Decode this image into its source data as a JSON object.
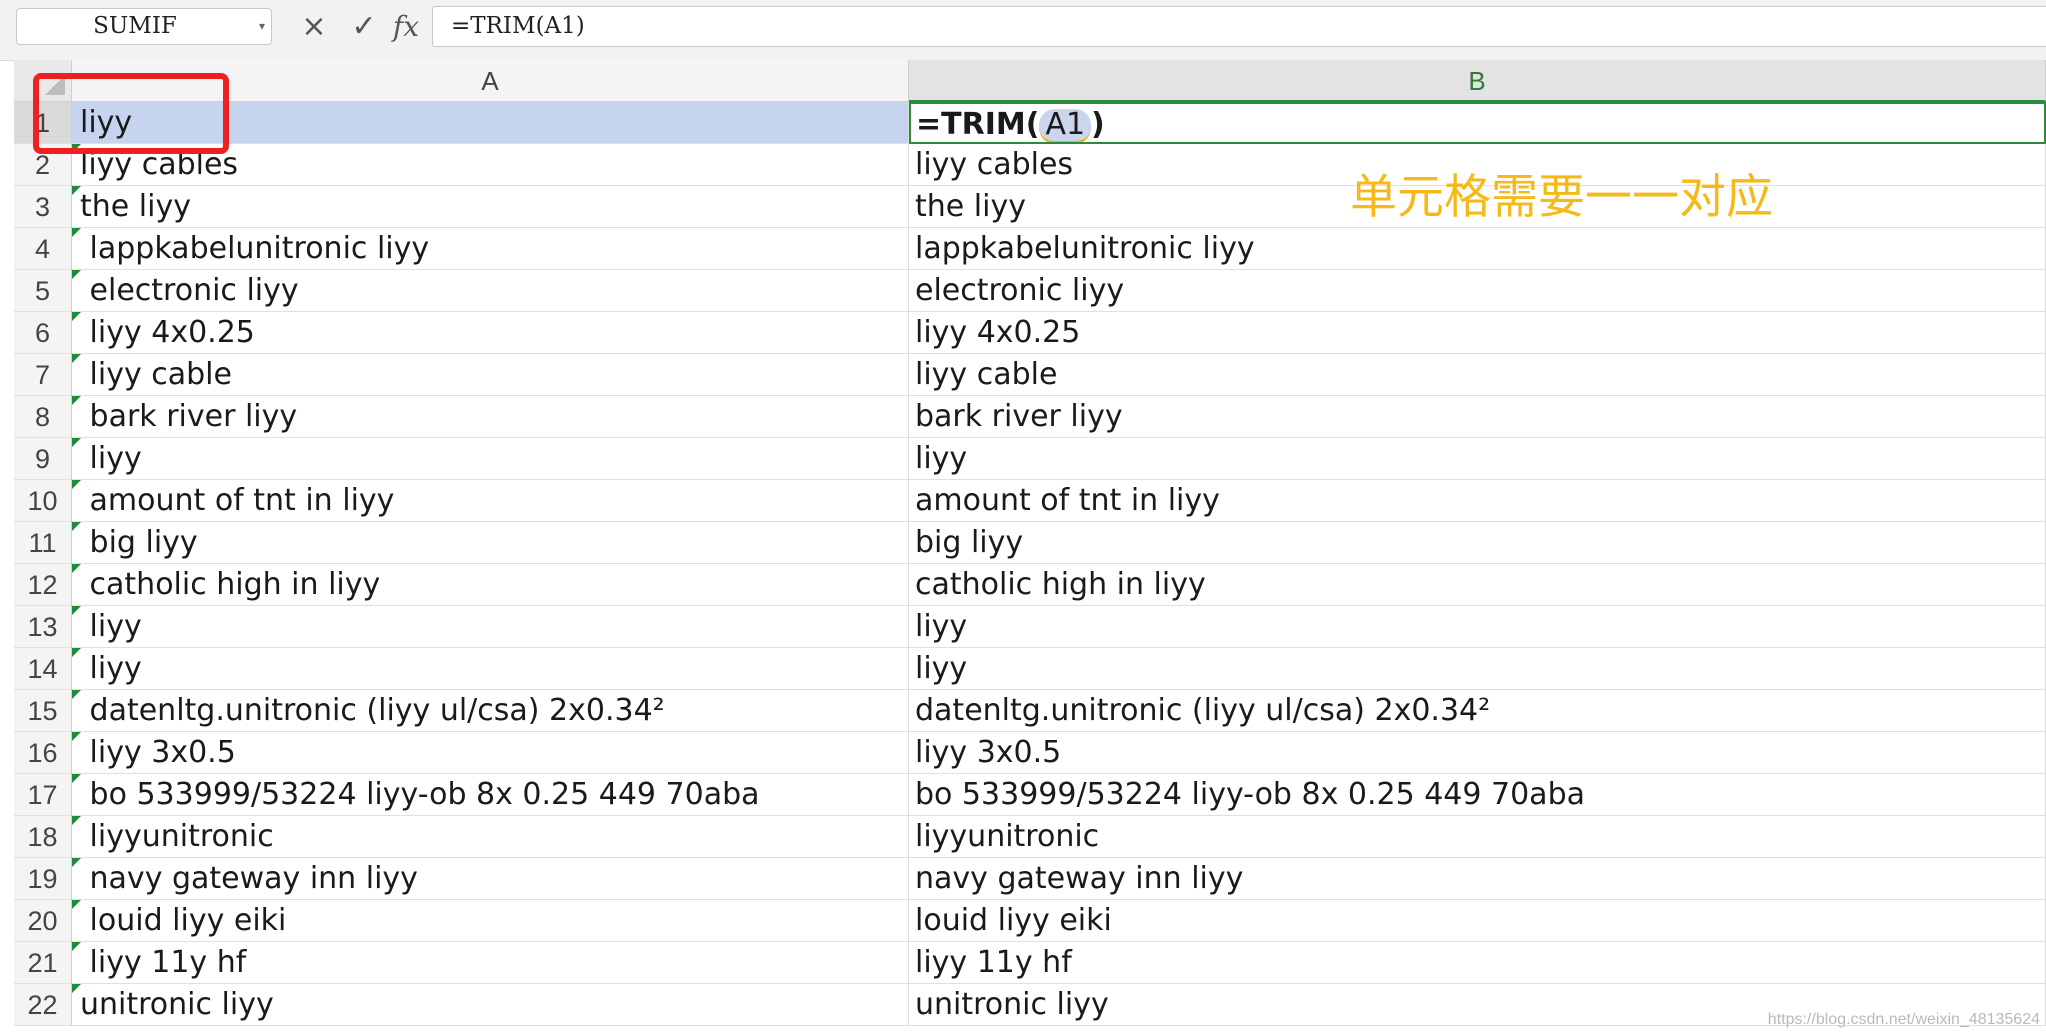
{
  "toolbar": {
    "name_box": "SUMIF",
    "cancel_glyph": "×",
    "confirm_glyph": "✓",
    "fx_label": "fx",
    "formula": "=TRIM(A1)"
  },
  "columns": [
    "A",
    "B"
  ],
  "cell_b1": {
    "prefix": "=TRIM(",
    "ref": "A1",
    "suffix": ")"
  },
  "rows": [
    {
      "num": "1",
      "a": "liyy",
      "b": ""
    },
    {
      "num": "2",
      "a": "liyy cables",
      "b": "liyy cables"
    },
    {
      "num": "3",
      "a": "the liyy",
      "b": "the liyy"
    },
    {
      "num": "4",
      "a": " lappkabelunitronic liyy",
      "b": "lappkabelunitronic liyy"
    },
    {
      "num": "5",
      "a": " electronic liyy",
      "b": "electronic liyy"
    },
    {
      "num": "6",
      "a": " liyy 4x0.25",
      "b": "liyy 4x0.25"
    },
    {
      "num": "7",
      "a": " liyy cable",
      "b": "liyy cable"
    },
    {
      "num": "8",
      "a": " bark river liyy",
      "b": "bark river liyy"
    },
    {
      "num": "9",
      "a": " liyy",
      "b": "liyy"
    },
    {
      "num": "10",
      "a": " amount of tnt in liyy",
      "b": "amount of tnt in liyy"
    },
    {
      "num": "11",
      "a": " big liyy",
      "b": "big liyy"
    },
    {
      "num": "12",
      "a": " catholic high in liyy",
      "b": "catholic high in liyy"
    },
    {
      "num": "13",
      "a": " liyy",
      "b": "liyy"
    },
    {
      "num": "14",
      "a": " liyy",
      "b": "liyy"
    },
    {
      "num": "15",
      "a": " datenltg.unitronic (liyy ul/csa) 2x0.34²",
      "b": "datenltg.unitronic (liyy ul/csa) 2x0.34²"
    },
    {
      "num": "16",
      "a": " liyy 3x0.5",
      "b": "liyy 3x0.5"
    },
    {
      "num": "17",
      "a": " bo 533999/53224 liyy-ob 8x 0.25 449 70aba",
      "b": "bo 533999/53224 liyy-ob 8x 0.25 449 70aba"
    },
    {
      "num": "18",
      "a": " liyyunitronic",
      "b": "liyyunitronic"
    },
    {
      "num": "19",
      "a": " navy gateway inn liyy",
      "b": "navy gateway inn liyy"
    },
    {
      "num": "20",
      "a": " louid liyy eiki",
      "b": "louid liyy eiki"
    },
    {
      "num": "21",
      "a": " liyy 11y hf",
      "b": "liyy 11y hf"
    },
    {
      "num": "22",
      "a": "unitronic liyy",
      "b": "unitronic liyy"
    }
  ],
  "annotation": "单元格需要一一对应",
  "watermark": "https://blog.csdn.net/weixin_48135624",
  "colors": {
    "active_column_header": "#2f7d32",
    "selection_fill": "#c6d4f0",
    "highlight_box": "#ef2020",
    "annotation": "#f6b91a"
  },
  "icons": [
    "cancel-icon",
    "confirm-icon",
    "fx-icon",
    "dropdown-arrow-icon"
  ]
}
